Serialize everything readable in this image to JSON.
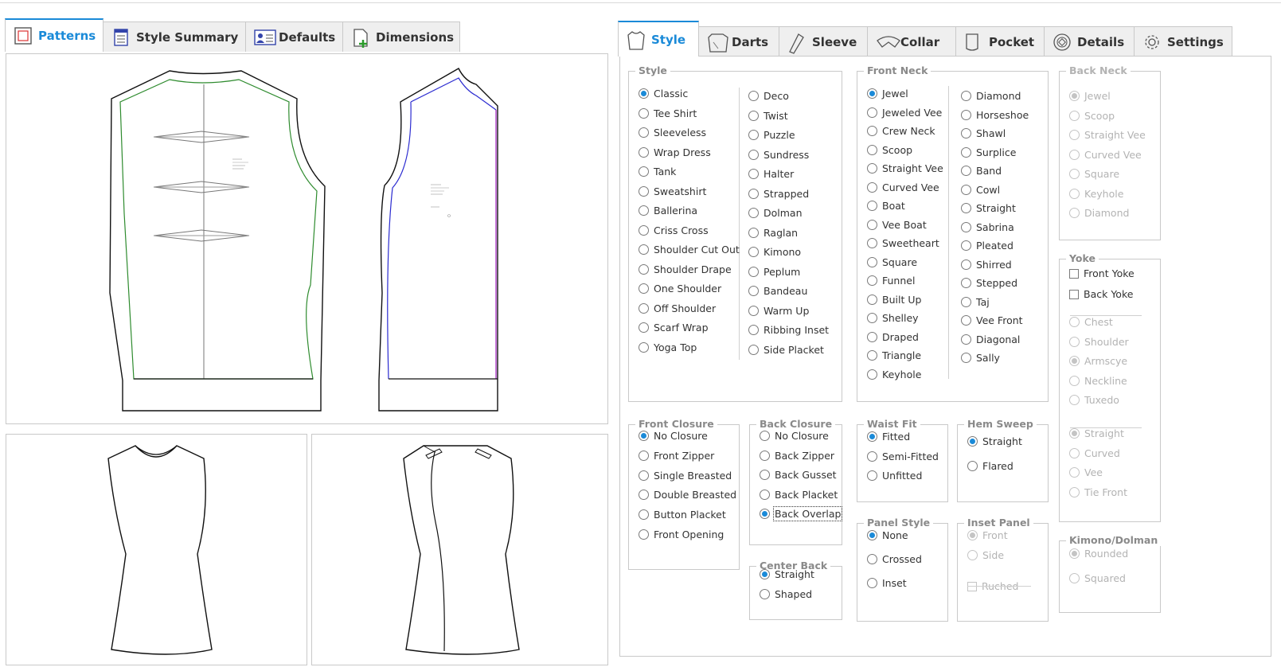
{
  "left_tabs": [
    {
      "label": "Patterns",
      "icon": "patterns-icon",
      "active": true
    },
    {
      "label": "Style Summary",
      "icon": "document-icon",
      "active": false
    },
    {
      "label": "Defaults",
      "icon": "user-card-icon",
      "active": false
    },
    {
      "label": "Dimensions",
      "icon": "add-document-icon",
      "active": false
    }
  ],
  "right_tabs": [
    {
      "label": "Style",
      "icon": "shirt-icon",
      "active": true
    },
    {
      "label": "Darts",
      "icon": "darts-icon",
      "active": false
    },
    {
      "label": "Sleeve",
      "icon": "sleeve-icon",
      "active": false
    },
    {
      "label": "Collar",
      "icon": "collar-icon",
      "active": false
    },
    {
      "label": "Pocket",
      "icon": "pocket-icon",
      "active": false
    },
    {
      "label": "Details",
      "icon": "details-icon",
      "active": false
    },
    {
      "label": "Settings",
      "icon": "gear-icon",
      "active": false
    }
  ],
  "style": {
    "title": "Style",
    "col1": [
      "Classic",
      "Tee Shirt",
      "Sleeveless",
      "Wrap Dress",
      "Tank",
      "Sweatshirt",
      "Ballerina",
      "Criss Cross",
      "Shoulder Cut Out",
      "Shoulder Drape",
      "One Shoulder",
      "Off Shoulder",
      "Scarf Wrap",
      "Yoga Top"
    ],
    "col2": [
      "Deco",
      "Twist",
      "Puzzle",
      "Sundress",
      "Halter",
      "Strapped",
      "Dolman",
      "Raglan",
      "Kimono",
      "Peplum",
      "Bandeau",
      "Warm Up",
      "Ribbing Inset",
      "Side Placket"
    ],
    "selected": "Classic"
  },
  "front_neck": {
    "title": "Front Neck",
    "col1": [
      "Jewel",
      "Jeweled Vee",
      "Crew Neck",
      "Scoop",
      "Straight Vee",
      "Curved Vee",
      "Boat",
      "Vee Boat",
      "Sweetheart",
      "Square",
      "Funnel",
      "Built Up",
      "Shelley",
      "Draped",
      "Triangle",
      "Keyhole"
    ],
    "col2": [
      "Diamond",
      "Horseshoe",
      "Shawl",
      "Surplice",
      "Band",
      "Cowl",
      "Straight",
      "Sabrina",
      "Pleated",
      "Shirred",
      "Stepped",
      "Taj",
      "Vee Front",
      "Diagonal",
      "Sally"
    ],
    "selected": "Jewel"
  },
  "back_neck": {
    "title": "Back Neck",
    "items": [
      "Jewel",
      "Scoop",
      "Straight Vee",
      "Curved Vee",
      "Square",
      "Keyhole",
      "Diamond"
    ],
    "selected": "Jewel"
  },
  "yoke": {
    "title": "Yoke",
    "checks": [
      "Front Yoke",
      "Back Yoke"
    ],
    "group1": [
      "Chest",
      "Shoulder",
      "Armscye",
      "Neckline",
      "Tuxedo"
    ],
    "group1_selected": "Armscye",
    "group2": [
      "Straight",
      "Curved",
      "Vee",
      "Tie Front"
    ],
    "group2_selected": "Straight"
  },
  "kimono": {
    "title": "Kimono/Dolman",
    "items": [
      "Rounded",
      "Squared"
    ],
    "selected": "Rounded"
  },
  "front_closure": {
    "title": "Front Closure",
    "items": [
      "No Closure",
      "Front Zipper",
      "Single Breasted",
      "Double Breasted",
      "Button Placket",
      "Front Opening"
    ],
    "selected": "No Closure"
  },
  "back_closure": {
    "title": "Back Closure",
    "items": [
      "No Closure",
      "Back Zipper",
      "Back Gusset",
      "Back Placket",
      "Back Overlap"
    ],
    "selected": "Back Overlap"
  },
  "center_back": {
    "title": "Center Back",
    "items": [
      "Straight",
      "Shaped"
    ],
    "selected": "Straight"
  },
  "waist_fit": {
    "title": "Waist Fit",
    "items": [
      "Fitted",
      "Semi-Fitted",
      "Unfitted"
    ],
    "selected": "Fitted"
  },
  "hem_sweep": {
    "title": "Hem Sweep",
    "items": [
      "Straight",
      "Flared"
    ],
    "selected": "Straight"
  },
  "panel_style": {
    "title": "Panel Style",
    "items": [
      "None",
      "Crossed",
      "Inset"
    ],
    "selected": "None"
  },
  "inset_panel": {
    "title": "Inset Panel",
    "items": [
      "Front",
      "Side"
    ],
    "selected": "Front",
    "check": "Ruched"
  },
  "colors": {
    "accent": "#1a8ad8",
    "front_seam": "#2e8b2e",
    "back_seam": "#2a2ad0",
    "center_line": "#a020c0"
  }
}
